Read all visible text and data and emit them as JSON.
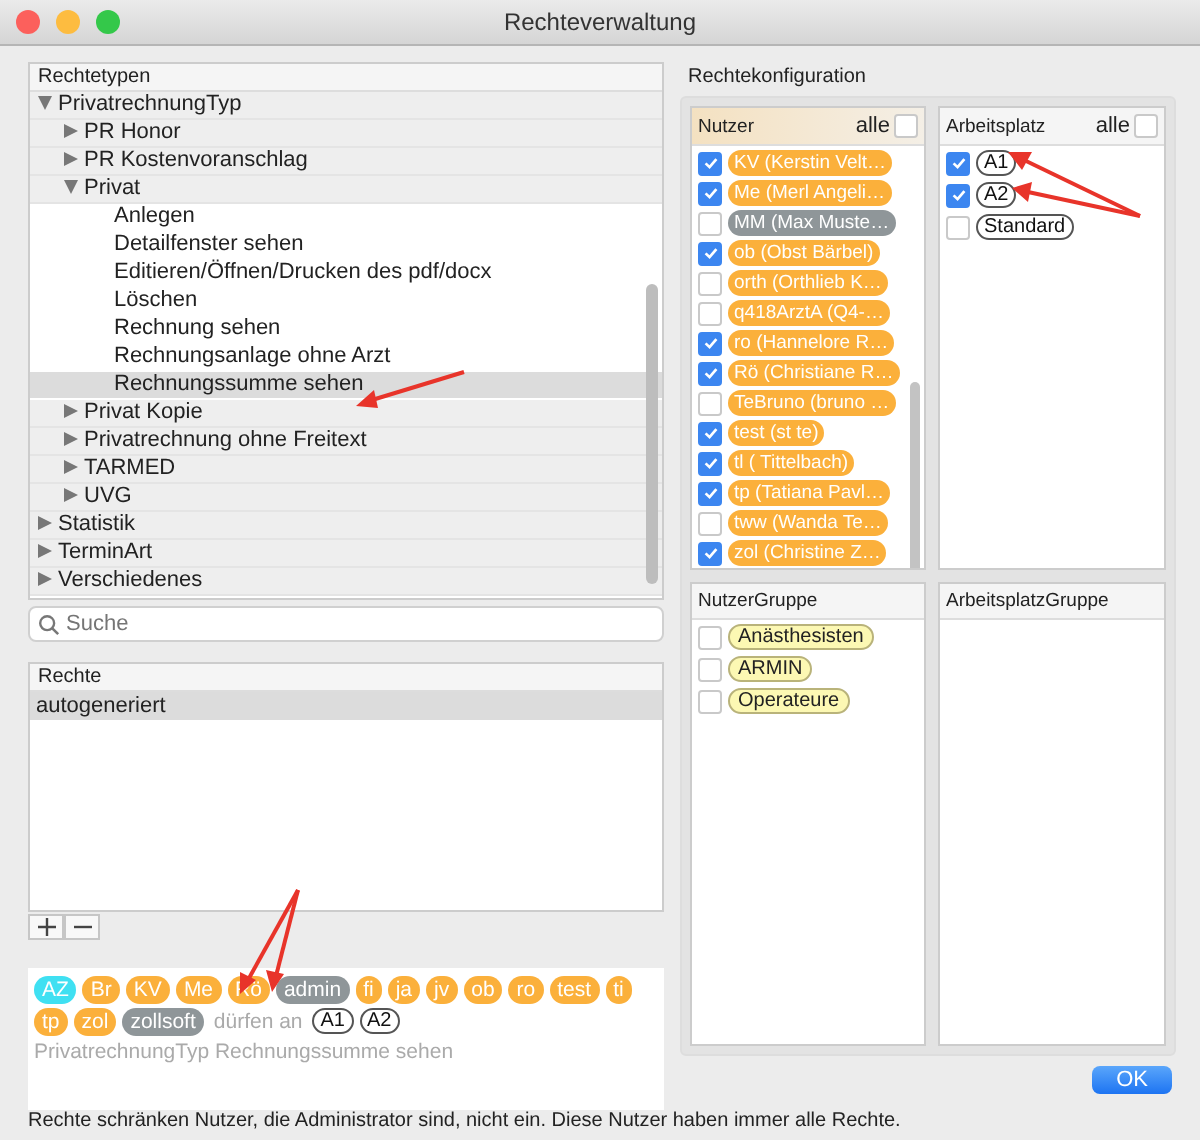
{
  "window": {
    "title": "Rechteverwaltung"
  },
  "rights_types": {
    "header": "Rechtetypen",
    "tree": [
      {
        "label": "PrivatrechnungTyp",
        "expanded": true,
        "children": [
          {
            "label": "PR Honor",
            "expanded": false
          },
          {
            "label": "PR Kostenvoranschlag",
            "expanded": false
          },
          {
            "label": "Privat",
            "expanded": true,
            "children": [
              {
                "label": "Anlegen",
                "selected": false
              },
              {
                "label": "Detailfenster sehen",
                "selected": false
              },
              {
                "label": "Editieren/Öffnen/Drucken des pdf/docx",
                "selected": false
              },
              {
                "label": "Löschen",
                "selected": false
              },
              {
                "label": "Rechnung sehen",
                "selected": false
              },
              {
                "label": "Rechnungsanlage ohne Arzt",
                "selected": false
              },
              {
                "label": "Rechnungssumme sehen",
                "selected": true
              }
            ]
          },
          {
            "label": "Privat Kopie",
            "expanded": false
          },
          {
            "label": "Privatrechnung ohne Freitext",
            "expanded": false
          },
          {
            "label": "TARMED",
            "expanded": false
          },
          {
            "label": "UVG",
            "expanded": false
          }
        ]
      },
      {
        "label": "Statistik",
        "expanded": false
      },
      {
        "label": "TerminArt",
        "expanded": false
      },
      {
        "label": "Verschiedenes",
        "expanded": false
      }
    ]
  },
  "search": {
    "placeholder": "Suche"
  },
  "rights": {
    "header": "Rechte",
    "rows": [
      {
        "label": "autogeneriert",
        "selected": true
      }
    ]
  },
  "summary": {
    "users": [
      {
        "label": "AZ",
        "color": "#3fe0f2"
      },
      {
        "label": "Br",
        "color": "#fbb03b"
      },
      {
        "label": "KV",
        "color": "#fbb03b"
      },
      {
        "label": "Me",
        "color": "#fbb03b"
      },
      {
        "label": "Rö",
        "color": "#fbb03b"
      },
      {
        "label": "admin",
        "color": "#8f9699"
      },
      {
        "label": "fi",
        "color": "#fbb03b"
      },
      {
        "label": "ja",
        "color": "#fbb03b"
      },
      {
        "label": "jv",
        "color": "#fbb03b"
      },
      {
        "label": "ob",
        "color": "#fbb03b"
      },
      {
        "label": "ro",
        "color": "#fbb03b"
      },
      {
        "label": "test",
        "color": "#fbb03b"
      },
      {
        "label": "ti",
        "color": "#fbb03b"
      },
      {
        "label": "tp",
        "color": "#fbb03b"
      },
      {
        "label": "zol",
        "color": "#fbb03b"
      },
      {
        "label": "zollsoft",
        "color": "#8f9699"
      }
    ],
    "connector": "dürfen an",
    "workstations": [
      "A1",
      "A2"
    ],
    "right_path": "PrivatrechnungTyp Rechnungssumme sehen"
  },
  "config": {
    "title": "Rechtekonfiguration",
    "users": {
      "header": "Nutzer",
      "all_label": "alle",
      "all_checked": false,
      "items": [
        {
          "label": "KV (Kerstin Velt…",
          "checked": true,
          "color": "#fbb03b"
        },
        {
          "label": "Me (Merl Angeli…",
          "checked": true,
          "color": "#fbb03b"
        },
        {
          "label": "MM (Max Muste…",
          "checked": false,
          "color": "#8f9699"
        },
        {
          "label": "ob (Obst Bärbel)",
          "checked": true,
          "color": "#fbb03b"
        },
        {
          "label": "orth (Orthlieb K…",
          "checked": false,
          "color": "#fbb03b"
        },
        {
          "label": "q418ArztA (Q4-…",
          "checked": false,
          "color": "#fbb03b"
        },
        {
          "label": "ro (Hannelore R…",
          "checked": true,
          "color": "#fbb03b"
        },
        {
          "label": "Rö (Christiane R…",
          "checked": true,
          "color": "#fbb03b"
        },
        {
          "label": "TeBruno (bruno …",
          "checked": false,
          "color": "#fbb03b"
        },
        {
          "label": "test (st te)",
          "checked": true,
          "color": "#fbb03b"
        },
        {
          "label": "tl ( Tittelbach)",
          "checked": true,
          "color": "#fbb03b"
        },
        {
          "label": "tp (Tatiana Pavl…",
          "checked": true,
          "color": "#fbb03b"
        },
        {
          "label": "tww (Wanda Te…",
          "checked": false,
          "color": "#fbb03b"
        },
        {
          "label": "zol (Christine Z…",
          "checked": true,
          "color": "#fbb03b"
        }
      ]
    },
    "workstations": {
      "header": "Arbeitsplatz",
      "all_label": "alle",
      "all_checked": false,
      "items": [
        {
          "label": "A1",
          "checked": true
        },
        {
          "label": "A2",
          "checked": true
        },
        {
          "label": "Standard",
          "checked": false
        }
      ]
    },
    "user_groups": {
      "header": "NutzerGruppe",
      "items": [
        {
          "label": "Anästhesisten",
          "checked": false
        },
        {
          "label": "ARMIN",
          "checked": false
        },
        {
          "label": "Operateure",
          "checked": false
        }
      ]
    },
    "workstation_groups": {
      "header": "ArbeitsplatzGruppe"
    }
  },
  "ok_button": "OK",
  "footer": "Rechte schränken Nutzer, die Administrator sind, nicht ein. Diese Nutzer haben immer alle Rechte."
}
